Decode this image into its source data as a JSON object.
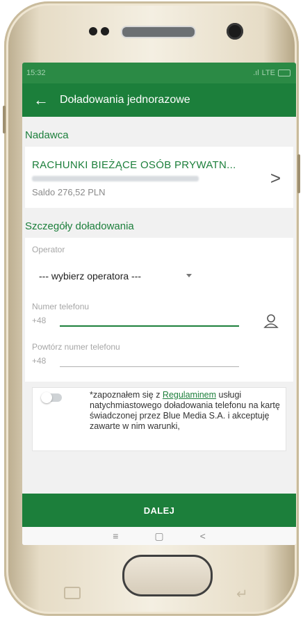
{
  "statusbar": {
    "time": "15:32",
    "network": "LTE"
  },
  "appbar": {
    "back_glyph": "←",
    "title": "Doładowania jednorazowe"
  },
  "sender": {
    "section_title": "Nadawca",
    "account_name": "RACHUNKI BIEŻĄCE OSÓB PRYWATN...",
    "balance": "Saldo 276,52 PLN"
  },
  "details": {
    "section_title": "Szczegóły doładowania",
    "operator_label": "Operator",
    "operator_value": "--- wybierz operatora ---",
    "phone_label": "Numer telefonu",
    "phone_prefix": "+48",
    "repeat_label": "Powtórz numer telefonu",
    "repeat_prefix": "+48"
  },
  "consent": {
    "text_before": "*zapoznałem się z ",
    "link": "Regulaminem",
    "text_after": " usługi natychmiastowego doładowania telefonu na kartę świadczonej przez Blue Media S.A. i akceptuję zawarte w nim warunki,"
  },
  "primary_button": "DALEJ",
  "nav": {
    "menu": "≡",
    "home": "▢",
    "back": "<"
  },
  "colors": {
    "brand_green": "#1c7f3b",
    "status_green": "#2b8a45"
  }
}
